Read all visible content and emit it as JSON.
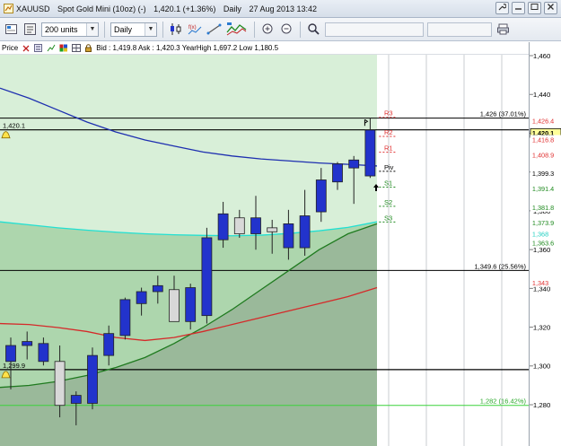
{
  "window": {
    "title_symbol": "XAUUSD",
    "title_name": "Spot Gold Mini (10oz) (-)",
    "title_price": "1,420.1 (+1.36%)",
    "title_period": "Daily",
    "title_datetime": "27 Aug 2013 13:42"
  },
  "toolbar": {
    "units_value": "200 units",
    "period_value": "Daily"
  },
  "infobar": {
    "price_label": "Price",
    "quote": "Bid : 1,419.8 Ask : 1,420.3 YearHigh 1,697.2 Low 1,180.5"
  },
  "chart_data": {
    "type": "candlestick",
    "instrument": "XAUUSD",
    "period": "Daily",
    "y_ticks": [
      "1,460",
      "1,440",
      "1,420",
      "1,400",
      "1,380",
      "1,360",
      "1,340",
      "1,320",
      "1,300",
      "1,280"
    ],
    "ylim": [
      1273,
      1466
    ],
    "candles": [
      {
        "o": 1304,
        "h": 1316,
        "l": 1290,
        "c": 1312
      },
      {
        "o": 1312,
        "h": 1319,
        "l": 1305,
        "c": 1314
      },
      {
        "o": 1304,
        "h": 1316,
        "l": 1302,
        "c": 1313
      },
      {
        "o": 1304,
        "h": 1312,
        "l": 1276,
        "c": 1282
      },
      {
        "o": 1283,
        "h": 1289,
        "l": 1272,
        "c": 1287
      },
      {
        "o": 1283,
        "h": 1311,
        "l": 1280,
        "c": 1307
      },
      {
        "o": 1307,
        "h": 1322,
        "l": 1302,
        "c": 1318
      },
      {
        "o": 1317,
        "h": 1336,
        "l": 1315,
        "c": 1335
      },
      {
        "o": 1333,
        "h": 1341,
        "l": 1327,
        "c": 1339
      },
      {
        "o": 1339,
        "h": 1347,
        "l": 1333,
        "c": 1342
      },
      {
        "o": 1340,
        "h": 1347,
        "l": 1328,
        "c": 1324
      },
      {
        "o": 1324,
        "h": 1343,
        "l": 1320,
        "c": 1341
      },
      {
        "o": 1327,
        "h": 1371,
        "l": 1323,
        "c": 1366
      },
      {
        "o": 1365,
        "h": 1384,
        "l": 1361,
        "c": 1378
      },
      {
        "o": 1376,
        "h": 1380,
        "l": 1366,
        "c": 1368
      },
      {
        "o": 1368,
        "h": 1387,
        "l": 1360,
        "c": 1376
      },
      {
        "o": 1371,
        "h": 1375,
        "l": 1358,
        "c": 1369
      },
      {
        "o": 1361,
        "h": 1380,
        "l": 1355,
        "c": 1373
      },
      {
        "o": 1361,
        "h": 1390,
        "l": 1357,
        "c": 1377
      },
      {
        "o": 1379,
        "h": 1401,
        "l": 1374,
        "c": 1395
      },
      {
        "o": 1394,
        "h": 1404,
        "l": 1390,
        "c": 1403
      },
      {
        "o": 1401,
        "h": 1407,
        "l": 1383,
        "c": 1405
      },
      {
        "o": 1397,
        "h": 1426,
        "l": 1396,
        "c": 1420
      }
    ],
    "moving_averages": [
      {
        "color": "#1e2fb0",
        "values": [
          1441,
          1436,
          1430,
          1424,
          1419,
          1415,
          1412,
          1409,
          1407,
          1405.5,
          1404.5,
          1403.5,
          1402.8,
          1402
        ]
      },
      {
        "color": "#22e0d2",
        "values": [
          1374,
          1372.5,
          1371,
          1369.8,
          1368.8,
          1368,
          1367.5,
          1367.2,
          1367,
          1367.3,
          1368.2,
          1369.5,
          1371.2,
          1374
        ]
      },
      {
        "color": "#1f7a1f",
        "values": [
          1291,
          1292,
          1294,
          1297,
          1301,
          1306,
          1313,
          1321,
          1330,
          1340,
          1350,
          1360,
          1368,
          1373
        ]
      },
      {
        "color": "#d52a2a",
        "values": [
          1323,
          1322.5,
          1321,
          1319,
          1316,
          1314.5,
          1316,
          1319,
          1322.5,
          1326,
          1329.5,
          1333,
          1336.5,
          1341
        ]
      }
    ],
    "horizontal_lines": [
      {
        "value": 1420.1,
        "label": "1,420.1",
        "color": "#000000"
      },
      {
        "value": 1299.9,
        "label": "1,299.9",
        "color": "#000000"
      }
    ],
    "fib_lines": [
      {
        "value": 1426,
        "label": "1,426 (37.01%)",
        "color": "#000000"
      },
      {
        "value": 1349.6,
        "label": "1,349.6 (25.56%)",
        "color": "#000000"
      },
      {
        "value": 1282,
        "label": "1,282 (16.42%)",
        "color": "#3ad23a"
      }
    ],
    "pivots": [
      {
        "name": "R3",
        "value": 1426.4,
        "color": "#e03030"
      },
      {
        "name": "R2",
        "value": 1416.8,
        "color": "#e03030"
      },
      {
        "name": "R1",
        "value": 1408.9,
        "color": "#e03030"
      },
      {
        "name": "Piv",
        "value": 1399.3,
        "color": "#000000"
      },
      {
        "name": "S1",
        "value": 1391.4,
        "color": "#1f8a1f"
      },
      {
        "name": "S2",
        "value": 1381.8,
        "color": "#1f8a1f"
      },
      {
        "name": "S3",
        "value": 1373.9,
        "color": "#1f8a1f"
      }
    ],
    "price_tags": [
      {
        "label": "1,426.4",
        "value": 1426.4,
        "color": "#e03030",
        "bg": "#ffffff"
      },
      {
        "label": "1,420.1",
        "value": 1420.1,
        "color": "#000000",
        "bg": "#ffff99"
      },
      {
        "label": "1,416.8",
        "value": 1416.8,
        "color": "#e03030",
        "bg": "#ffffff"
      },
      {
        "label": "1,408.9",
        "value": 1408.9,
        "color": "#e03030",
        "bg": "#ffffff"
      },
      {
        "label": "1,399.3",
        "value": 1399.3,
        "color": "#000000",
        "bg": "#ffffff"
      },
      {
        "label": "1,391.4",
        "value": 1391.4,
        "color": "#1f8a1f",
        "bg": "#ffffff"
      },
      {
        "label": "1,381.8",
        "value": 1381.8,
        "color": "#1f8a1f",
        "bg": "#ffffff"
      },
      {
        "label": "1,373.9",
        "value": 1373.9,
        "color": "#1f8a1f",
        "bg": "#ffffff"
      },
      {
        "label": "1,368",
        "value": 1368,
        "color": "#22d0c2",
        "bg": "#ffffff"
      },
      {
        "label": "1,363.6",
        "value": 1363.6,
        "color": "#1f8a1f",
        "bg": "#ffffff"
      },
      {
        "label": "1,343",
        "value": 1343,
        "color": "#e03030",
        "bg": "#ffffff"
      }
    ],
    "colors": {
      "bull_body": "#2233cc",
      "bear_body": "#d8d8d8",
      "history_bg": "#d8efd8",
      "area_fill": "#8faf8f",
      "vgrid": "#c8ccd2"
    }
  }
}
